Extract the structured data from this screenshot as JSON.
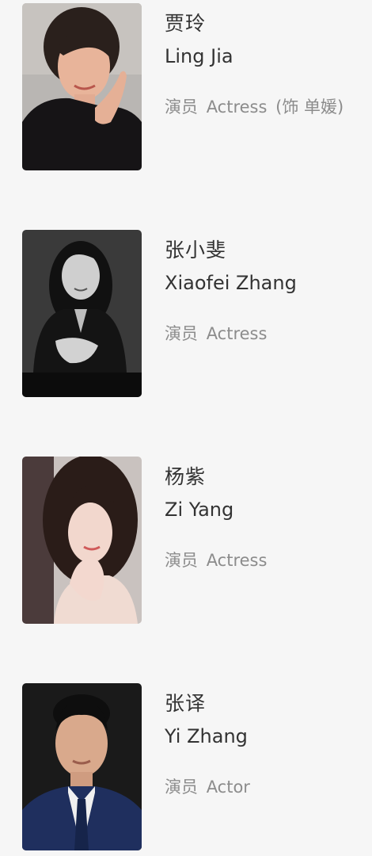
{
  "cast": [
    {
      "name_cn": "贾玲",
      "name_en": "Ling Jia",
      "role_cn": "演员",
      "role_en": "Actress",
      "role_note": "(饰 单媛)",
      "photo_icon": "portrait-photo"
    },
    {
      "name_cn": "张小斐",
      "name_en": "Xiaofei Zhang",
      "role_cn": "演员",
      "role_en": "Actress",
      "role_note": "",
      "photo_icon": "portrait-photo"
    },
    {
      "name_cn": "杨紫",
      "name_en": "Zi Yang",
      "role_cn": "演员",
      "role_en": "Actress",
      "role_note": "",
      "photo_icon": "portrait-photo"
    },
    {
      "name_cn": "张译",
      "name_en": "Yi Zhang",
      "role_cn": "演员",
      "role_en": "Actor",
      "role_note": "",
      "photo_icon": "portrait-photo"
    }
  ]
}
